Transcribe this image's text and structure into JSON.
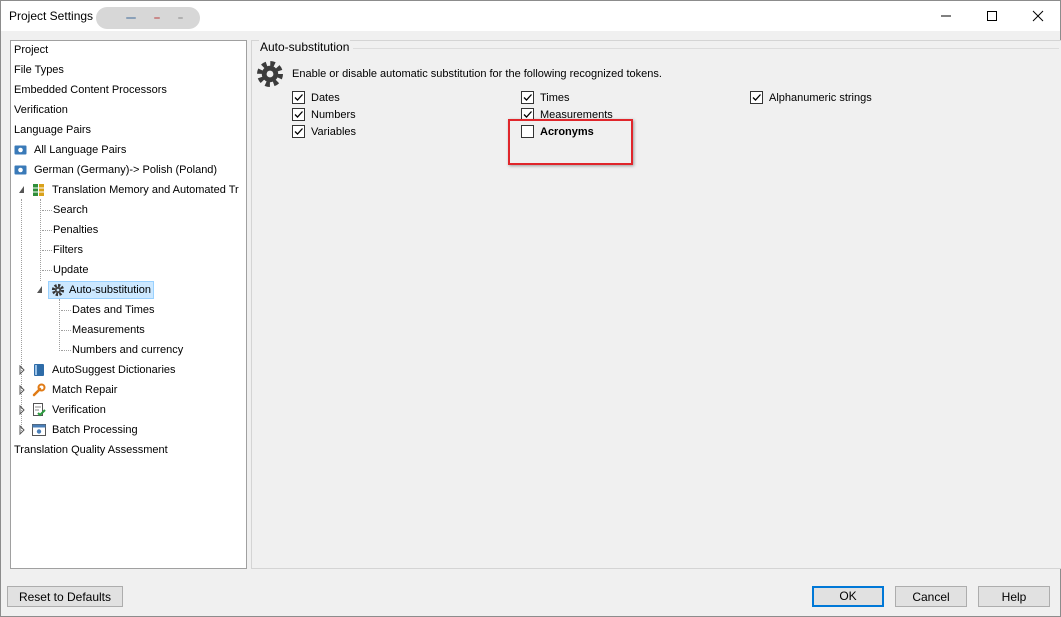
{
  "window": {
    "title": "Project Settings",
    "minimize": "minimize",
    "maximize": "maximize",
    "close": "close"
  },
  "tree": {
    "items": [
      {
        "label": "Project"
      },
      {
        "label": "File Types"
      },
      {
        "label": "Embedded Content Processors"
      },
      {
        "label": "Verification"
      },
      {
        "label": "Language Pairs"
      },
      {
        "label": "All Language Pairs",
        "icon": "language-pair-icon"
      },
      {
        "label": "German (Germany)-> Polish (Poland)",
        "icon": "language-pair-icon"
      },
      {
        "label": "Translation Memory and Automated Tr",
        "icon": "translation-memory-icon",
        "expanded": true
      },
      {
        "label": "Search"
      },
      {
        "label": "Penalties"
      },
      {
        "label": "Filters"
      },
      {
        "label": "Update"
      },
      {
        "label": "Auto-substitution",
        "icon": "gear-icon",
        "expanded": true,
        "selected": true
      },
      {
        "label": "Dates and Times"
      },
      {
        "label": "Measurements"
      },
      {
        "label": "Numbers and currency"
      },
      {
        "label": "AutoSuggest Dictionaries",
        "icon": "dictionary-icon",
        "expanded": false
      },
      {
        "label": "Match Repair",
        "icon": "wrench-icon",
        "expanded": false
      },
      {
        "label": "Verification",
        "icon": "verification-icon",
        "expanded": false
      },
      {
        "label": "Batch Processing",
        "icon": "batch-icon",
        "expanded": false
      },
      {
        "label": "Translation Quality Assessment"
      }
    ]
  },
  "panel": {
    "group_title": "Auto-substitution",
    "description": "Enable or disable automatic substitution for the following recognized tokens.",
    "checkboxes": [
      {
        "label": "Dates",
        "checked": true
      },
      {
        "label": "Numbers",
        "checked": true
      },
      {
        "label": "Variables",
        "checked": true
      },
      {
        "label": "Times",
        "checked": true
      },
      {
        "label": "Measurements",
        "checked": true
      },
      {
        "label": "Acronyms",
        "checked": false
      },
      {
        "label": "Alphanumeric strings",
        "checked": true
      }
    ]
  },
  "buttons": {
    "reset": "Reset to Defaults",
    "ok": "OK",
    "cancel": "Cancel",
    "help": "Help"
  },
  "colors": {
    "selection_bg": "#cce8ff",
    "highlight_border": "#e0262b",
    "default_button_border": "#0078d7"
  }
}
